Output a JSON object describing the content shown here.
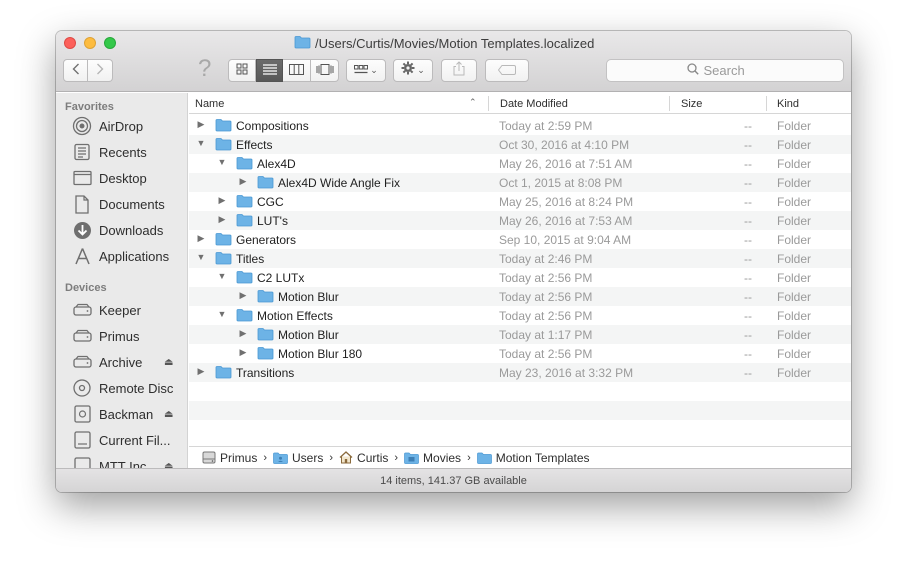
{
  "window": {
    "title": "/Users/Curtis/Movies/Motion Templates.localized"
  },
  "toolbar": {
    "search_placeholder": "Search",
    "back_icon": "chevron-left-icon",
    "forward_icon": "chevron-right-icon",
    "help_label": "?"
  },
  "sidebar": {
    "favorites_title": "Favorites",
    "favorites": [
      {
        "label": "AirDrop",
        "icon": "airdrop-icon"
      },
      {
        "label": "Recents",
        "icon": "recents-icon"
      },
      {
        "label": "Desktop",
        "icon": "desktop-icon"
      },
      {
        "label": "Documents",
        "icon": "documents-icon"
      },
      {
        "label": "Downloads",
        "icon": "downloads-icon"
      },
      {
        "label": "Applications",
        "icon": "applications-icon"
      }
    ],
    "devices_title": "Devices",
    "devices": [
      {
        "label": "Keeper",
        "icon": "drive-icon"
      },
      {
        "label": "Primus",
        "icon": "drive-icon"
      },
      {
        "label": "Archive",
        "icon": "drive-icon"
      },
      {
        "label": "Remote Disc",
        "icon": "disc-icon"
      },
      {
        "label": "Backman",
        "icon": "drive-icon"
      },
      {
        "label": "Current Fil...",
        "icon": "drive-icon"
      },
      {
        "label": "MTT Inc",
        "icon": "drive-icon"
      }
    ]
  },
  "columns": {
    "name": "Name",
    "date": "Date Modified",
    "size": "Size",
    "kind": "Kind"
  },
  "files": [
    {
      "name": "Compositions",
      "date": "Today at 2:59 PM",
      "size": "--",
      "kind": "Folder"
    },
    {
      "name": "Effects",
      "date": "Oct 30, 2016 at 4:10 PM",
      "size": "--",
      "kind": "Folder"
    },
    {
      "name": "Alex4D",
      "date": "May 26, 2016 at 7:51 AM",
      "size": "--",
      "kind": "Folder"
    },
    {
      "name": "Alex4D Wide Angle Fix",
      "date": "Oct 1, 2015 at 8:08 PM",
      "size": "--",
      "kind": "Folder"
    },
    {
      "name": "CGC",
      "date": "May 25, 2016 at 8:24 PM",
      "size": "--",
      "kind": "Folder"
    },
    {
      "name": "LUT's",
      "date": "May 26, 2016 at 7:53 AM",
      "size": "--",
      "kind": "Folder"
    },
    {
      "name": "Generators",
      "date": "Sep 10, 2015 at 9:04 AM",
      "size": "--",
      "kind": "Folder"
    },
    {
      "name": "Titles",
      "date": "Today at 2:46 PM",
      "size": "--",
      "kind": "Folder"
    },
    {
      "name": "C2 LUTx",
      "date": "Today at 2:56 PM",
      "size": "--",
      "kind": "Folder"
    },
    {
      "name": "Motion Blur",
      "date": "Today at 2:56 PM",
      "size": "--",
      "kind": "Folder"
    },
    {
      "name": "Motion Effects",
      "date": "Today at 2:56 PM",
      "size": "--",
      "kind": "Folder"
    },
    {
      "name": "Motion Blur",
      "date": "Today at 1:17 PM",
      "size": "--",
      "kind": "Folder"
    },
    {
      "name": "Motion Blur 180",
      "date": "Today at 2:56 PM",
      "size": "--",
      "kind": "Folder"
    },
    {
      "name": "Transitions",
      "date": "May 23, 2016 at 3:32 PM",
      "size": "--",
      "kind": "Folder"
    }
  ],
  "pathbar": [
    {
      "label": "Primus",
      "icon": "drive-icon"
    },
    {
      "label": "Users",
      "icon": "folder-icon"
    },
    {
      "label": "Curtis",
      "icon": "home-icon"
    },
    {
      "label": "Movies",
      "icon": "folder-icon"
    },
    {
      "label": "Motion Templates",
      "icon": "folder-icon"
    }
  ],
  "status": {
    "text": "14 items, 141.37 GB available"
  },
  "colors": {
    "folder": "#6db3e6",
    "folder_dark": "#4a98d3",
    "close": "#fc605b",
    "minimize": "#fdbc40",
    "zoom": "#34c84a"
  }
}
